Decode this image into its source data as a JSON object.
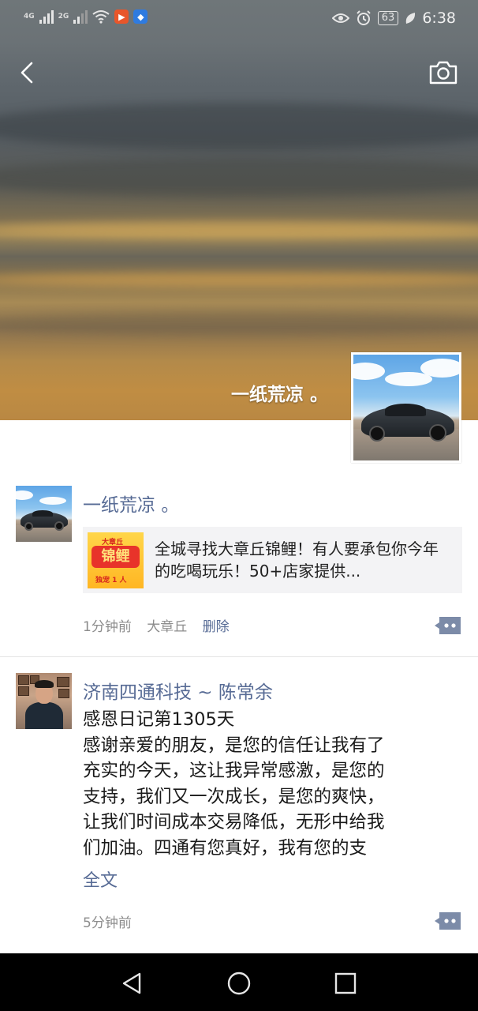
{
  "status_bar": {
    "network_1": "4G",
    "network_2": "2G",
    "battery": "63",
    "time": "6:38"
  },
  "cover": {
    "user_name": "一纸荒凉 。"
  },
  "posts": [
    {
      "author": "一纸荒凉 。",
      "link_card": {
        "thumb_top": "大章丘",
        "thumb_main": "锦鲤",
        "thumb_bottom": "独宠 1 人",
        "title": "全城寻找大章丘锦鲤！有人要承包你今年的吃喝玩乐！50+店家提供..."
      },
      "time": "1分钟前",
      "location": "大章丘",
      "delete_label": "删除"
    },
    {
      "author": "济南四通科技 ~ 陈常余",
      "text_lines": [
        "感恩日记第1305天",
        "感谢亲爱的朋友，是您的信任让我有了",
        "充实的今天，这让我异常感激，是您的",
        "支持，我们又一次成长，是您的爽快，",
        "让我们时间成本交易降低，无形中给我",
        "们加油。四通有您真好，我有您的支"
      ],
      "full_text_label": "全文",
      "time": "5分钟前"
    }
  ],
  "icons": {
    "back": "chevron-left-icon",
    "camera": "camera-icon",
    "more": "comment-more-icon"
  },
  "colors": {
    "link_blue": "#576b95",
    "meta_gray": "#8c8c8c"
  }
}
